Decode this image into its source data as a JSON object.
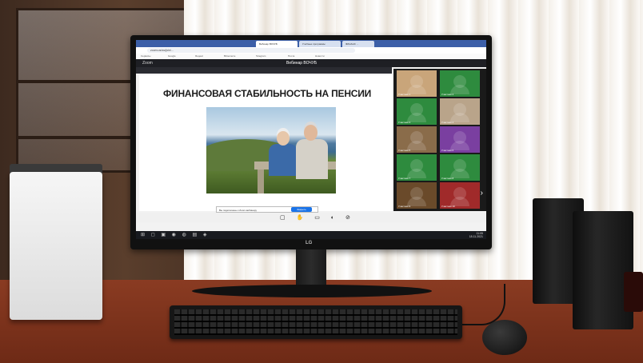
{
  "photo": {
    "monitor_brand": "LG",
    "browser": {
      "tabs": [
        "Вебинар ВОЧУБ",
        "Учебные программы",
        "ФИНАНС ..."
      ],
      "address": "zoom.us/wc/join/...",
      "bookmarks": [
        "Сервисы",
        "Google",
        "Яндекс",
        "ВКонтакте",
        "Telegram",
        "Почта",
        "Новости"
      ]
    },
    "zoom": {
      "app_name": "Zoom",
      "window_title": "Вебинар ВОЧУБ",
      "slide_title": "ФИНАНСОВАЯ СТАБИЛЬНОСТЬ НА ПЕНСИИ",
      "caption_text": "Вы подключены к Zoom-вебинару",
      "caption_button": "Закрыть",
      "participants": [
        {
          "label": "Участник 1",
          "color": "#c9a57a"
        },
        {
          "label": "Участник 2",
          "color": "#2e8b3e"
        },
        {
          "label": "Участник 3",
          "color": "#2e8b3e"
        },
        {
          "label": "Участник 4",
          "color": "#b9a48a"
        },
        {
          "label": "Участник 5",
          "color": "#8a6c4a"
        },
        {
          "label": "Участник 6",
          "color": "#7a3fa0"
        },
        {
          "label": "Участник 7",
          "color": "#2e8b3e"
        },
        {
          "label": "Участник 8",
          "color": "#2e8b3e"
        },
        {
          "label": "Участник 9",
          "color": "#6a4a2a"
        },
        {
          "label": "Участник 10",
          "color": "#a02a2a"
        }
      ]
    },
    "taskbar": {
      "time": "11:05",
      "date": "18.11.2021"
    }
  }
}
